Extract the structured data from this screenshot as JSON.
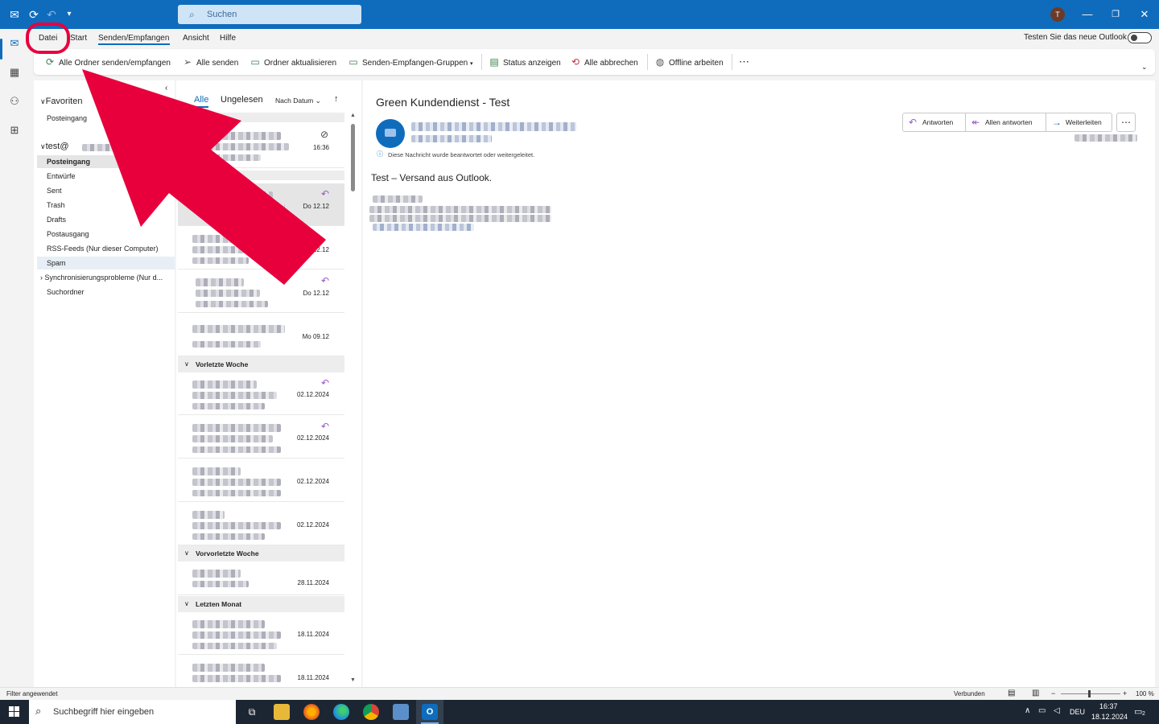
{
  "titlebar": {
    "search_placeholder": "Suchen",
    "avatar_initial": "T"
  },
  "menu": {
    "tabs": [
      "Datei",
      "Start",
      "Senden/Empfangen",
      "Ansicht",
      "Hilfe"
    ],
    "active_tab": "Senden/Empfangen",
    "toggle_label": "Testen Sie das neue Outlook"
  },
  "ribbon": {
    "send_receive_all": "Alle Ordner senden/empfangen",
    "send_all": "Alle senden",
    "update_folder": "Ordner aktualisieren",
    "send_receive_groups": "Senden-Empfangen-Gruppen",
    "show_progress": "Status anzeigen",
    "cancel_all": "Alle abbrechen",
    "work_offline": "Offline arbeiten",
    "more": "⋯"
  },
  "folders": {
    "favorites_label": "Favoriten",
    "favorites": [
      "Posteingang"
    ],
    "account_label": "test@",
    "items": [
      "Posteingang",
      "Entwürfe",
      "Sent",
      "Trash",
      "Drafts",
      "Postausgang",
      "RSS-Feeds (Nur dieser Computer)",
      "Spam",
      "Synchronisierungsprobleme (Nur d...",
      "Suchordner"
    ],
    "selected": "Posteingang"
  },
  "list": {
    "filter_all": "Alle",
    "filter_unread": "Ungelesen",
    "sort_label": "Nach Datum",
    "groups": {
      "g1": "Vorletzte Woche",
      "g2": "Vorvorletzte Woche",
      "g3": "Letzten Monat"
    },
    "mails": [
      {
        "date": "16:36"
      },
      {
        "date": "Do 12.12"
      },
      {
        "date": "12.12"
      },
      {
        "date": "Do 12.12"
      },
      {
        "date": "Mo 09.12"
      },
      {
        "date": "02.12.2024"
      },
      {
        "date": "02.12.2024"
      },
      {
        "date": "02.12.2024"
      },
      {
        "date": "02.12.2024"
      },
      {
        "date": "28.11.2024"
      },
      {
        "date": "18.11.2024"
      },
      {
        "date": "18.11.2024"
      }
    ]
  },
  "reading": {
    "subject": "Green Kundendienst - Test",
    "info": "Diese Nachricht wurde beantwortet oder weitergeleitet.",
    "body": "Test – Versand aus Outlook.",
    "reply": "Antworten",
    "reply_all": "Allen antworten",
    "forward": "Weiterleiten",
    "more": "⋯"
  },
  "statusbar": {
    "left": "Filter angewendet",
    "connection": "Verbunden",
    "zoom": "100 %"
  },
  "taskbar": {
    "search_placeholder": "Suchbegriff hier eingeben",
    "lang": "DEU",
    "time": "16:37",
    "date": "18.12.2024",
    "notif_count": "2"
  },
  "colors": {
    "brand": "#0f6cbd",
    "annotation": "#e8003d"
  }
}
